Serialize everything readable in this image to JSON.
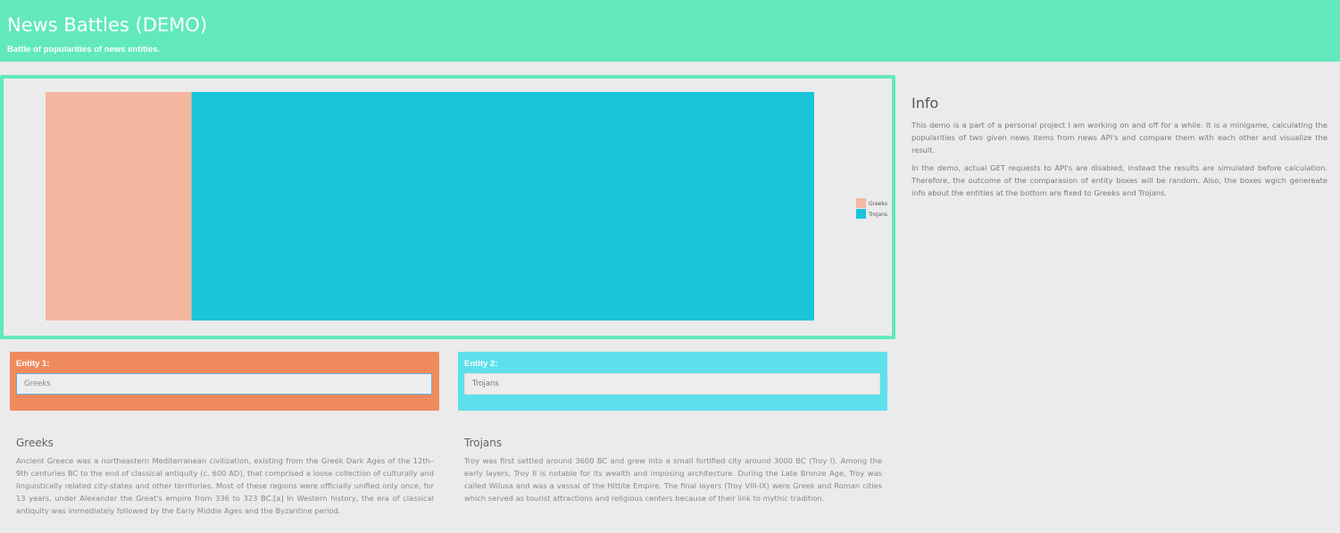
{
  "header": {
    "title": "News Battles (DEMO)",
    "subtitle": "Battle of popularities of news entities."
  },
  "chart_data": {
    "type": "bar",
    "stacked": true,
    "orientation": "horizontal",
    "series": [
      {
        "name": "Greeks",
        "value": 19,
        "color": "#f4b7a0"
      },
      {
        "name": "Trojans",
        "value": 81,
        "color": "#1cc4da"
      }
    ],
    "legend_position": "right",
    "grid": false
  },
  "info": {
    "title": "Info",
    "paragraphs": [
      "This demo is a part of a personal project I am working on and off for a while. It is a minigame, calculating the popularities of two given news items from news API's and compare them with each other and visualize the result.",
      "In the demo, actual GET requests to API's are disabled, instead the results are simulated before calculation. Therefore, the outcome of the comparasion of entity boxes will be random. Also, the boxes wgich genereate info about the entities at the bottom are fixed to Greeks and Trojans."
    ]
  },
  "entity1": {
    "label": "Entity 1:",
    "value": "Greeks",
    "color": "#ef8a5e"
  },
  "entity2": {
    "label": "Entity 2:",
    "value": "",
    "placeholder": "Trojans",
    "color": "#5ddfed"
  },
  "descriptions": {
    "greeks": {
      "title": "Greeks",
      "text": "Ancient Greece was a northeastern Mediterranean civilization, existing from the Greek Dark Ages of the 12th–9th centuries BC to the end of classical antiquity (c. 600 AD), that comprised a loose collection of culturally and linguistically related city-states and other territories. Most of these regions were officially unified only once, for 13 years, under Alexander the Great's empire from 336 to 323 BC.[a] In Western history, the era of classical antiquity was immediately followed by the Early Middle Ages and the Byzantine period."
    },
    "trojans": {
      "title": "Trojans",
      "text": "Troy was first settled around 3600 BC and grew into a small fortified city around 3000 BC (Troy I). Among the early layers, Troy II is notable for its wealth and imposing architecture. During the Late Bronze Age, Troy was called Wilusa and was a vassal of the Hittite Empire. The final layers (Troy VIII-IX) were Greek and Roman cities which served as tourist attractions and religious centers because of their link to mythic tradition."
    }
  }
}
